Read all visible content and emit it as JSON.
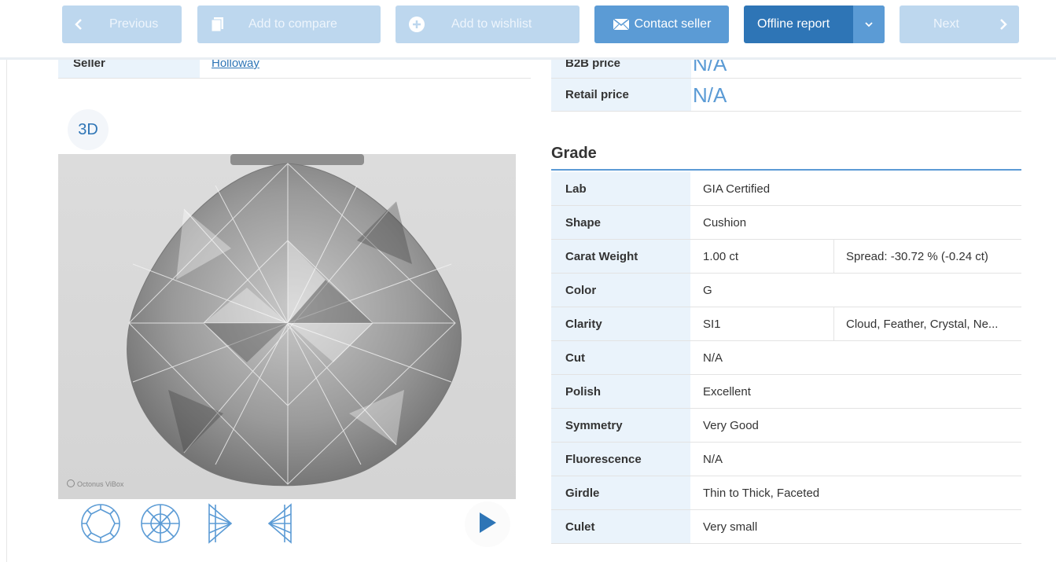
{
  "toolbar": {
    "previous_label": "Previous",
    "compare_label": "Add to compare",
    "wishlist_label": "Add to wishlist",
    "contact_label": "Contact seller",
    "report_label": "Offline report",
    "next_label": "Next"
  },
  "seller": {
    "label": "Seller",
    "value": "Holloway"
  },
  "prices": [
    {
      "label": "B2B price",
      "value": "N/A"
    },
    {
      "label": "Retail price",
      "value": "N/A"
    }
  ],
  "viewer": {
    "button_3d": "3D",
    "watermark": "Octonus ViBox"
  },
  "grade": {
    "title": "Grade",
    "rows": [
      {
        "label": "Lab",
        "value": "GIA Certified",
        "extra": ""
      },
      {
        "label": "Shape",
        "value": "Cushion",
        "extra": ""
      },
      {
        "label": "Carat Weight",
        "value": "1.00 ct",
        "extra": "Spread: -30.72 % (-0.24 ct)"
      },
      {
        "label": "Color",
        "value": "G",
        "extra": ""
      },
      {
        "label": "Clarity",
        "value": "SI1",
        "extra": "Cloud, Feather, Crystal, Ne..."
      },
      {
        "label": "Cut",
        "value": "N/A",
        "extra": ""
      },
      {
        "label": "Polish",
        "value": "Excellent",
        "extra": ""
      },
      {
        "label": "Symmetry",
        "value": "Very Good",
        "extra": ""
      },
      {
        "label": "Fluorescence",
        "value": "N/A",
        "extra": ""
      },
      {
        "label": "Girdle",
        "value": "Thin to Thick, Faceted",
        "extra": ""
      },
      {
        "label": "Culet",
        "value": "Very small",
        "extra": ""
      }
    ]
  },
  "colors": {
    "primary": "#5b9bd5",
    "primary_dark": "#2e75b6",
    "disabled": "#bdd7ee",
    "label_bg": "#eaf3fb"
  }
}
